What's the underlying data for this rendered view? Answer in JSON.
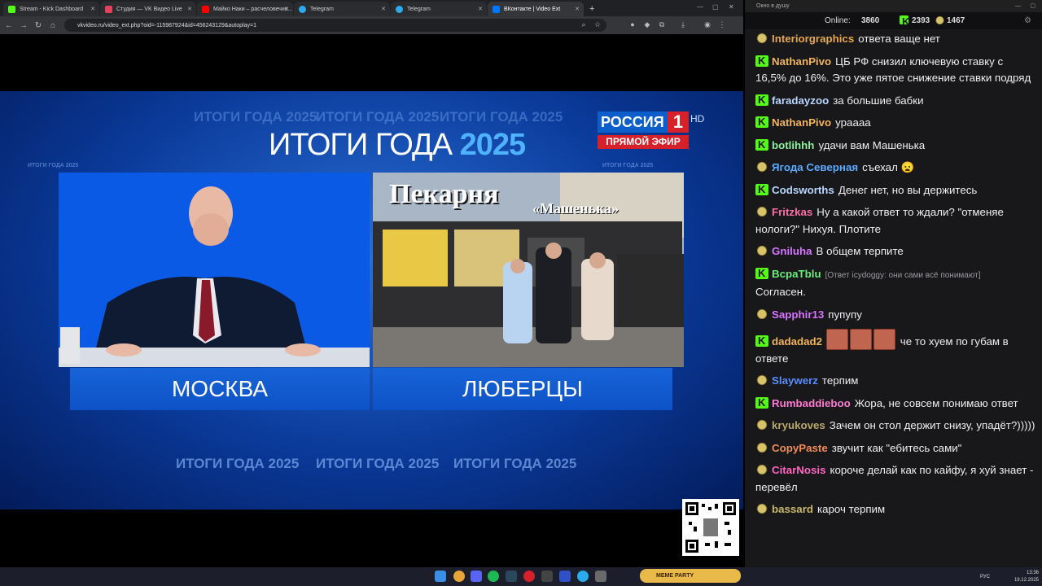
{
  "browser": {
    "tabs": [
      {
        "label": "Stream - Kick Dashboard",
        "color": "#53fc18"
      },
      {
        "label": "Студия — VK Видео Live",
        "color": "#e4405f"
      },
      {
        "label": "Майко Наки – расчеловечив...",
        "color": "#ff0000"
      },
      {
        "label": "Telegram",
        "color": "#2aabee"
      },
      {
        "label": "Telegram",
        "color": "#2aabee"
      },
      {
        "label": "ВКонтакте | Video Ext",
        "color": "#0077ff"
      }
    ],
    "url": "vkvideo.ru/video_ext.php?oid=-115987924&id=456243129&autoplay=1"
  },
  "video": {
    "bg_text": "ИТОГИ ГОДА 2025",
    "title_main": "ИТОГИ ГОДА",
    "title_year": "2025",
    "logo_channel": "РОССИЯ",
    "logo_number": "1",
    "logo_hd": "HD",
    "logo_live": "ПРЯМОЙ ЭФИР",
    "sign_text": "Пекарня",
    "sign_sub": "«Машенька»",
    "caption_left": "МОСКВА",
    "caption_right": "ЛЮБЕРЦЫ"
  },
  "chat": {
    "window_title": "Окно в душу",
    "online_label": "Online:",
    "online_count": "3860",
    "kick_count": "2393",
    "vk_count": "1467",
    "messages": [
      {
        "platform": "vk",
        "user": "Interiorgraphics",
        "color": "#e6a84a",
        "text": "ответа ваще нет"
      },
      {
        "platform": "kick",
        "user": "NathanPivo",
        "color": "#f2b45c",
        "text": "ЦБ РФ снизил ключевую ставку с 16,5% до 16%. Это уже пятое снижение ставки подряд"
      },
      {
        "platform": "kick",
        "user": "faradayzoo",
        "color": "#b9d6ff",
        "text": "за большие бабки"
      },
      {
        "platform": "kick",
        "user": "NathanPivo",
        "color": "#f2b45c",
        "text": "ураааа"
      },
      {
        "platform": "kick",
        "user": "botlihhh",
        "color": "#8cf29a",
        "text": "удачи вам Машенька"
      },
      {
        "platform": "vk",
        "user": "Ягода Северная",
        "color": "#5aaaff",
        "text": "съехал 😦"
      },
      {
        "platform": "kick",
        "user": "Codsworths",
        "color": "#b9d6ff",
        "text": "Денег нет, но вы держитесь"
      },
      {
        "platform": "vk",
        "user": "Fritzkas",
        "color": "#ff6ea8",
        "text": "Ну а какой ответ то ждали? \"отменяе нологи?\" Нихуя. Плотите"
      },
      {
        "platform": "vk",
        "user": "Gniluha",
        "color": "#d774ff",
        "text": "В общем терпите"
      },
      {
        "platform": "kick",
        "user": "BcpaTblu",
        "color": "#6af07a",
        "reply": "[Ответ icydoggy: они сами всё понимают]",
        "text": "Согласен."
      },
      {
        "platform": "vk",
        "user": "Sapphir13",
        "color": "#d774ff",
        "text": "пупупу"
      },
      {
        "platform": "kick",
        "user": "dadadad2",
        "color": "#f2b45c",
        "emotes": 3,
        "text": "че то хуем по губам в ответе"
      },
      {
        "platform": "vk",
        "user": "Slaywerz",
        "color": "#5a8cff",
        "text": "терпим"
      },
      {
        "platform": "kick",
        "user": "Rumbaddieboo",
        "color": "#ff7ad1",
        "text": "Жора, не совсем понимаю ответ"
      },
      {
        "platform": "vk",
        "user": "kryukoves",
        "color": "#b9a86a",
        "text": "Зачем он стол держит снизу, упадёт?)))))"
      },
      {
        "platform": "vk",
        "user": "CopyPaste",
        "color": "#f08c5a",
        "text": "звучит как \"ебитесь сами\""
      },
      {
        "platform": "vk",
        "user": "CitarNosis",
        "color": "#ff66c4",
        "text": "короче делай как по кайфу, я хуй знает - перевёл"
      },
      {
        "platform": "vk",
        "user": "bassard",
        "color": "#c8b86a",
        "text": "кароч терпим"
      }
    ]
  },
  "taskbar": {
    "lang": "РУС",
    "time": "13:36",
    "date": "19.12.2025",
    "widget": "MEME PARTY"
  }
}
